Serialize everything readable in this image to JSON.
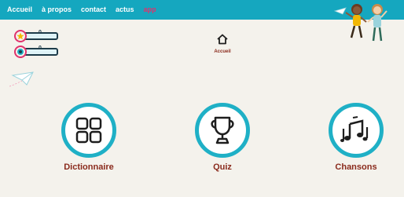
{
  "nav": {
    "items": [
      {
        "label": "Accueil"
      },
      {
        "label": "à propos"
      },
      {
        "label": "contact"
      },
      {
        "label": "actus"
      },
      {
        "label": "app"
      }
    ]
  },
  "counters": {
    "stars": "0",
    "points": "0"
  },
  "home": {
    "label": "Accueil"
  },
  "tiles": [
    {
      "label": "Dictionnaire",
      "icon": "grid-icon"
    },
    {
      "label": "Quiz",
      "icon": "trophy-icon"
    },
    {
      "label": "Chansons",
      "icon": "music-notes-icon"
    }
  ],
  "colors": {
    "topbar": "#15a7bf",
    "accent": "#e0326b",
    "ring": "#1fb0c6",
    "label": "#8a2a1c"
  }
}
